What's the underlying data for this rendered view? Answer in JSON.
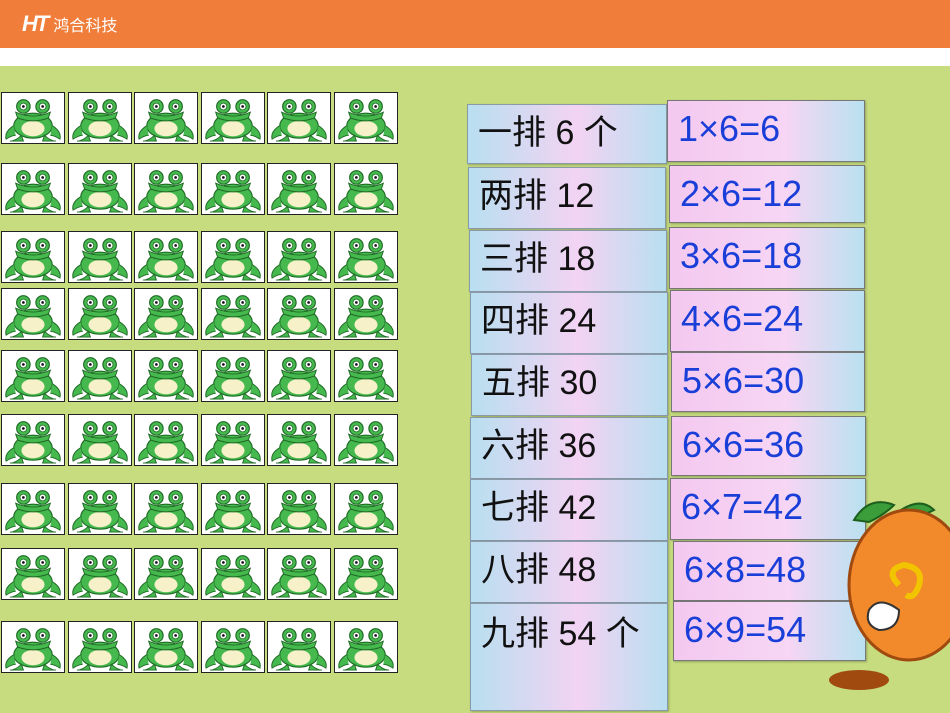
{
  "header": {
    "logo_mark": "HT",
    "company": "鸿合科技"
  },
  "grid": {
    "rows": 9,
    "cols": 6,
    "icon": "frog-icon"
  },
  "row_labels": [
    "一排 6 个",
    "两排 12",
    "三排 18",
    "四排 24",
    "五排 30",
    "六排 36",
    "七排 42",
    "八排 48",
    "九排 54 个"
  ],
  "formulas": [
    "1×6=6",
    "2×6=12",
    "3×6=18",
    "4×6=24",
    "5×6=30",
    "6×6=36",
    "6×7=42",
    "6×8=48",
    "6×9=54"
  ],
  "colors": {
    "header": "#f07e3a",
    "stage": "#c6dc7f",
    "frog_green": "#3fb34a",
    "formula_text": "#1a3ed8"
  },
  "mascot_icon": "orange-mascot-icon"
}
